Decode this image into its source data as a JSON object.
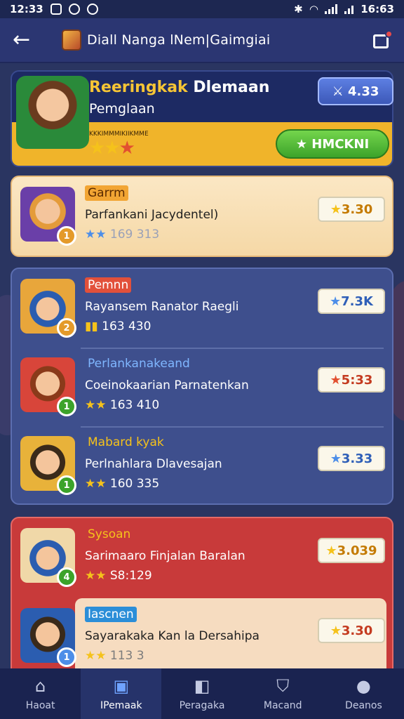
{
  "status": {
    "time": "12:33",
    "clock": "16:63"
  },
  "app": {
    "title": "Diall Nanga lNem|Gaimgiai"
  },
  "hero": {
    "title_a": "Reeringkak",
    "title_b": "Dlemaan",
    "subtitle": "Pemglaan",
    "mini": "KKKIMMMIKIIKMME",
    "rating": "4.33",
    "button": "HMCKNI",
    "stars": "★★★"
  },
  "players": [
    {
      "tag": "Garrm",
      "name": "Parfankani Jacydentel)",
      "stats": "169  313",
      "rating": "3.30",
      "rank": "1"
    },
    {
      "tag": "Pemnn",
      "name": "Rayansem Ranator Raegli",
      "stats": "163  430",
      "rating": "7.3K",
      "rank": "2"
    },
    {
      "tag": "Perlankanakeand",
      "name": "Coeinokaarian Parnatenkan",
      "stats": "163  410",
      "rating": "5:33",
      "rank": "1"
    },
    {
      "tag": "Mabard kyak",
      "name": "Perlnahlara Dlavesajan",
      "stats": "160  335",
      "rating": "3.33",
      "rank": "1"
    },
    {
      "tag": "Sysoan",
      "name": "Sarimaaro Finjalan Baralan",
      "stats": "S8:129",
      "rating": "3.039",
      "rank": "4"
    },
    {
      "tag": "Iascnen",
      "name": "Sayarakaka Kan la Dersahipa",
      "stats": "113  3",
      "rating": "3.30",
      "rank": "1"
    }
  ],
  "tabs": [
    {
      "label": "Haoat",
      "icon": "home-icon"
    },
    {
      "label": "IPemaak",
      "icon": "ranking-icon"
    },
    {
      "label": "Peragaka",
      "icon": "game-icon"
    },
    {
      "label": "Macand",
      "icon": "shield-icon"
    },
    {
      "label": "Deanos",
      "icon": "profile-icon"
    }
  ],
  "colors": {
    "accent_gold": "#f0b42a",
    "accent_green": "#3ca32a",
    "panel_red": "#c83a3a",
    "panel_blue": "#3e4f8d"
  }
}
